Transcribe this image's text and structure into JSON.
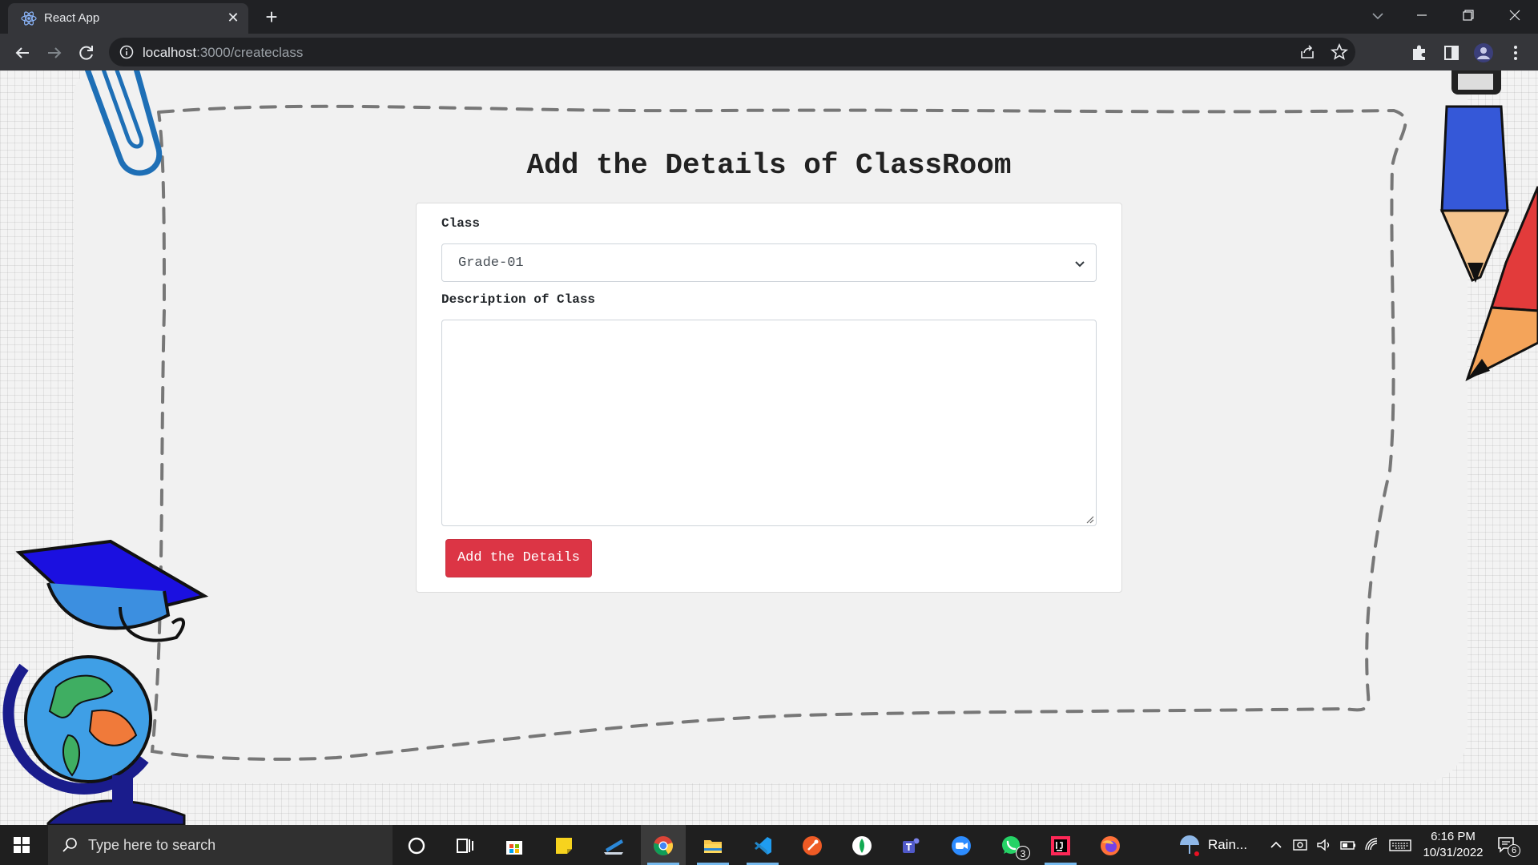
{
  "browser": {
    "tab_title": "React App",
    "url_host": "localhost",
    "url_path": ":3000/createclass"
  },
  "page": {
    "title": "Add the Details of ClassRoom",
    "class_label": "Class",
    "class_selected": "Grade-01",
    "description_label": "Description of Class",
    "description_value": "",
    "submit_label": "Add the Details"
  },
  "colors": {
    "button": "#dc3545",
    "browser_frame": "#202124",
    "toolbar": "#35363a"
  },
  "taskbar": {
    "search_placeholder": "Type here to search",
    "weather_text": "Rain...",
    "time": "6:16 PM",
    "date": "10/31/2022",
    "whatsapp_badge": "3",
    "notification_count": "6",
    "apps": [
      "cortana",
      "task-view",
      "microsoft-store",
      "sticky-notes",
      "laptop-app",
      "chrome",
      "file-explorer",
      "vs-code",
      "postman",
      "mongodb-compass",
      "teams",
      "zoom",
      "whatsapp",
      "intellij",
      "firefox"
    ]
  }
}
